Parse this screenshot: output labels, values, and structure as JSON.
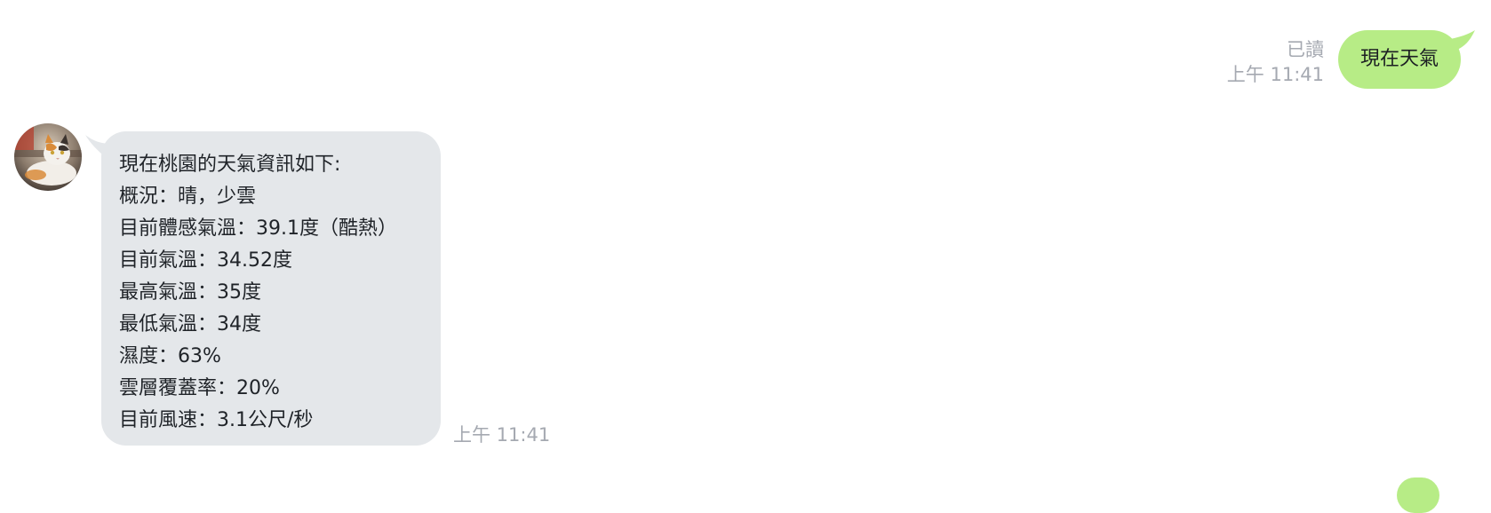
{
  "chat": {
    "outgoing": {
      "text": "現在天氣",
      "read_label": "已讀",
      "time": "上午 11:41",
      "bubble_color": "#b7ec86"
    },
    "incoming": {
      "avatar_icon": "cat-avatar",
      "bubble_color": "#e4e7ea",
      "lines": [
        "現在桃園的天氣資訊如下:",
        "概況：晴，少雲",
        "目前體感氣溫：39.1度（酷熱）",
        "目前氣溫：34.52度",
        "最高氣溫：35度",
        "最低氣溫：34度",
        "濕度：63%",
        "雲層覆蓋率：20%",
        "目前風速：3.1公尺/秒"
      ],
      "time": "上午 11:41"
    }
  }
}
